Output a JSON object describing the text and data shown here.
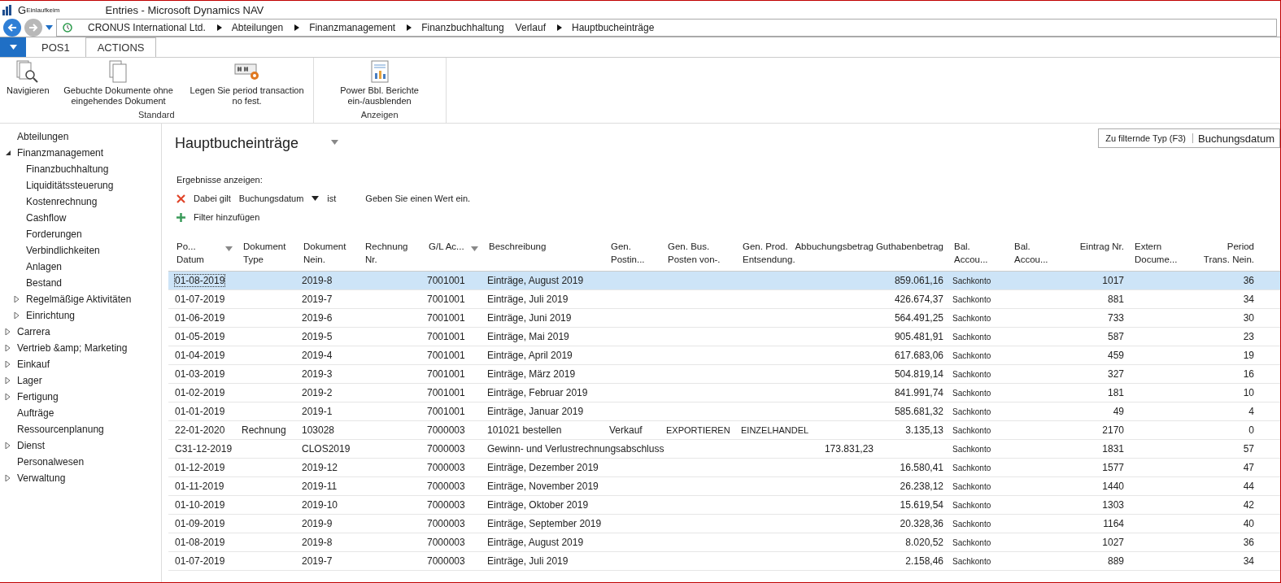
{
  "window": {
    "app_badge": "G",
    "app_caption": "Einlaufkeim",
    "title": "Entries - Microsoft Dynamics NAV"
  },
  "breadcrumb": [
    {
      "label": "CRONUS International Ltd.",
      "arrow": false
    },
    {
      "label": "Abteilungen",
      "arrow": true
    },
    {
      "label": "Finanzmanagement",
      "arrow": true
    },
    {
      "label": "Finanzbuchhaltung",
      "arrow": true
    },
    {
      "label": "Verlauf",
      "arrow": false
    },
    {
      "label": "Hauptbucheinträge",
      "arrow": true
    }
  ],
  "tabs": [
    {
      "label": "POS1",
      "selected": false
    },
    {
      "label": "ACTIONS",
      "selected": true
    }
  ],
  "ribbon_groups": [
    {
      "label": "Standard",
      "actions": [
        {
          "kind": "navigate",
          "label": "Navigieren"
        },
        {
          "kind": "documents",
          "label": "Gebuchte Dokumente ohne eingehendes Dokument"
        },
        {
          "kind": "numbers",
          "label": "Legen Sie period transaction no fest."
        }
      ]
    },
    {
      "label": "Anzeigen",
      "actions": [
        {
          "kind": "report",
          "label": "Power Bbl. Berichte ein-/ausblenden"
        }
      ]
    }
  ],
  "sidebar": {
    "items": [
      {
        "label": "Abteilungen"
      },
      {
        "label": "Finanzmanagement",
        "expanded": true,
        "children": [
          {
            "label": "Finanzbuchhaltung"
          },
          {
            "label": "Liquiditätssteuerung"
          },
          {
            "label": "Kostenrechnung"
          },
          {
            "label": "Cashflow"
          },
          {
            "label": "Forderungen"
          },
          {
            "label": "Verbindlichkeiten"
          },
          {
            "label": "Anlagen"
          },
          {
            "label": "Bestand"
          },
          {
            "label": "Regelmäßige Aktivitäten",
            "expanded": false
          },
          {
            "label": "Einrichtung",
            "expanded": false
          }
        ]
      },
      {
        "label": "Carrera",
        "expanded": false
      },
      {
        "label": "Vertrieb &amp; Marketing",
        "expanded": false
      },
      {
        "label": "Einkauf",
        "expanded": false
      },
      {
        "label": "Lager",
        "expanded": false
      },
      {
        "label": "Fertigung",
        "expanded": false
      },
      {
        "label": "Aufträge"
      },
      {
        "label": "Ressourcenplanung"
      },
      {
        "label": "Dienst",
        "expanded": false
      },
      {
        "label": "Personalwesen"
      },
      {
        "label": "Verwaltung",
        "expanded": false
      }
    ]
  },
  "page": {
    "title": "Hauptbucheinträge",
    "quick_filter": {
      "label": "Zu filternde Typ (F3)",
      "value": "Buchungsdatum"
    },
    "filter": {
      "heading": "Ergebnisse anzeigen:",
      "condition": "Dabei gilt",
      "field": "Buchungsdatum",
      "operator": "ist",
      "value_placeholder": "Geben Sie einen Wert ein.",
      "add": "Filter hinzufügen"
    }
  },
  "table": {
    "columns": [
      {
        "label": "Po... Datum",
        "menu": true
      },
      {
        "label": "Dokument Type",
        "menu": false
      },
      {
        "label": "Dokument Nein.",
        "menu": false
      },
      {
        "label": "Rechnung Nr.",
        "menu": false
      },
      {
        "label": "G/L Ac...",
        "menu": true
      },
      {
        "label": "Beschreibung",
        "menu": false
      },
      {
        "label": "Gen. Postin...",
        "menu": false
      },
      {
        "label": "Gen. Bus. Posten von-.",
        "menu": false
      },
      {
        "label": "Gen. Prod. Entsendung.",
        "menu": false
      },
      {
        "label": "Abbuchungsbetrag",
        "menu": false
      },
      {
        "label": "Guthabenbetrag",
        "menu": false
      },
      {
        "label": "Bal. Accou...",
        "menu": false
      },
      {
        "label": "Bal. Accou...",
        "menu": false
      },
      {
        "label": "Eintrag Nr.",
        "menu": false
      },
      {
        "label": "Extern Docume...",
        "menu": false
      },
      {
        "label": "Period Trans. Nein.",
        "menu": false
      }
    ],
    "rows": [
      {
        "selected": true,
        "cells": [
          "01-08-2019",
          null,
          "2019-8",
          null,
          "7001001",
          "Einträge, August 2019",
          null,
          null,
          null,
          null,
          "859.061,16",
          "Sachkonto",
          null,
          "1017",
          null,
          "36"
        ]
      },
      {
        "selected": false,
        "cells": [
          "01-07-2019",
          null,
          "2019-7",
          null,
          "7001001",
          "Einträge, Juli 2019",
          null,
          null,
          null,
          null,
          "426.674,37",
          "Sachkonto",
          null,
          "881",
          null,
          "34"
        ]
      },
      {
        "selected": false,
        "cells": [
          "01-06-2019",
          null,
          "2019-6",
          null,
          "7001001",
          "Einträge, Juni 2019",
          null,
          null,
          null,
          null,
          "564.491,25",
          "Sachkonto",
          null,
          "733",
          null,
          "30"
        ]
      },
      {
        "selected": false,
        "cells": [
          "01-05-2019",
          null,
          "2019-5",
          null,
          "7001001",
          "Einträge, Mai 2019",
          null,
          null,
          null,
          null,
          "905.481,91",
          "Sachkonto",
          null,
          "587",
          null,
          "23"
        ]
      },
      {
        "selected": false,
        "cells": [
          "01-04-2019",
          null,
          "2019-4",
          null,
          "7001001",
          "Einträge, April 2019",
          null,
          null,
          null,
          null,
          "617.683,06",
          "Sachkonto",
          null,
          "459",
          null,
          "19"
        ]
      },
      {
        "selected": false,
        "cells": [
          "01-03-2019",
          null,
          "2019-3",
          null,
          "7001001",
          "Einträge, März 2019",
          null,
          null,
          null,
          null,
          "504.819,14",
          "Sachkonto",
          null,
          "327",
          null,
          "16"
        ]
      },
      {
        "selected": false,
        "cells": [
          "01-02-2019",
          null,
          "2019-2",
          null,
          "7001001",
          "Einträge, Februar 2019",
          null,
          null,
          null,
          null,
          "841.991,74",
          "Sachkonto",
          null,
          "181",
          null,
          "10"
        ]
      },
      {
        "selected": false,
        "cells": [
          "01-01-2019",
          null,
          "2019-1",
          null,
          "7001001",
          "Einträge, Januar 2019",
          null,
          null,
          null,
          null,
          "585.681,32",
          "Sachkonto",
          null,
          "49",
          null,
          "4"
        ]
      },
      {
        "selected": false,
        "cells": [
          "22-01-2020",
          "Rechnung",
          "103028",
          null,
          "7000003",
          "101021 bestellen",
          "Verkauf",
          "EXPORTIEREN",
          "EINZELHANDEL",
          null,
          "3.135,13",
          "Sachkonto",
          null,
          "2170",
          null,
          "0"
        ]
      },
      {
        "selected": false,
        "cells": [
          "C31-12-2019",
          null,
          "CLOS2019",
          null,
          "7000003",
          "Gewinn- und Verlustrechnungsabschluss",
          null,
          null,
          null,
          "173.831,23",
          null,
          "Sachkonto",
          null,
          "1831",
          null,
          "57"
        ]
      },
      {
        "selected": false,
        "cells": [
          "01-12-2019",
          null,
          "2019-12",
          null,
          "7000003",
          "Einträge, Dezember 2019",
          null,
          null,
          null,
          null,
          "16.580,41",
          "Sachkonto",
          null,
          "1577",
          null,
          "47"
        ]
      },
      {
        "selected": false,
        "cells": [
          "01-11-2019",
          null,
          "2019-11",
          null,
          "7000003",
          "Einträge, November 2019",
          null,
          null,
          null,
          null,
          "26.238,12",
          "Sachkonto",
          null,
          "1440",
          null,
          "44"
        ]
      },
      {
        "selected": false,
        "cells": [
          "01-10-2019",
          null,
          "2019-10",
          null,
          "7000003",
          "Einträge, Oktober 2019",
          null,
          null,
          null,
          null,
          "15.619,54",
          "Sachkonto",
          null,
          "1303",
          null,
          "42"
        ]
      },
      {
        "selected": false,
        "cells": [
          "01-09-2019",
          null,
          "2019-9",
          null,
          "7000003",
          "Einträge, September 2019",
          null,
          null,
          null,
          null,
          "20.328,36",
          "Sachkonto",
          null,
          "1164",
          null,
          "40"
        ]
      },
      {
        "selected": false,
        "cells": [
          "01-08-2019",
          null,
          "2019-8",
          null,
          "7000003",
          "Einträge, August 2019",
          null,
          null,
          null,
          null,
          "8.020,52",
          "Sachkonto",
          null,
          "1027",
          null,
          "36"
        ]
      },
      {
        "selected": false,
        "cells": [
          "01-07-2019",
          null,
          "2019-7",
          null,
          "7000003",
          "Einträge, Juli 2019",
          null,
          null,
          null,
          null,
          "2.158,46",
          "Sachkonto",
          null,
          "889",
          null,
          "34"
        ]
      }
    ]
  }
}
